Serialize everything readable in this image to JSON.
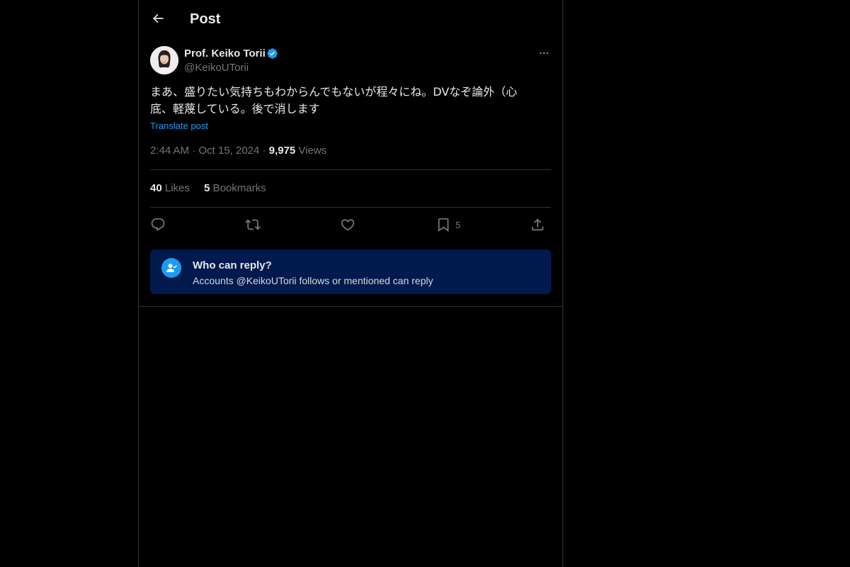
{
  "header": {
    "title": "Post"
  },
  "post": {
    "author_name": "Prof. Keiko Torii",
    "author_handle": "@KeikoUTorii",
    "verified": true,
    "text": "まあ、盛りたい気持ちもわからんでもないが程々にね。DVなぞ論外（心\n底、軽蔑している。後で消します",
    "translate_label": "Translate post",
    "timestamp": "2:44 AM · Oct 15, 2024",
    "meta_separator": " · ",
    "views_count": "9,975",
    "views_label": " Views"
  },
  "stats": {
    "likes_count": "40",
    "likes_label": " Likes",
    "bookmarks_count": "5",
    "bookmarks_label": " Bookmarks"
  },
  "actions": {
    "bookmark_count": "5"
  },
  "who_can_reply": {
    "title": "Who can reply?",
    "description": "Accounts @KeikoUTorii follows or mentioned can reply"
  },
  "colors": {
    "background": "#000000",
    "text_primary": "#e7e9ea",
    "text_secondary": "#71767b",
    "accent": "#1d9bf0",
    "border": "#2f3336",
    "reply_box": "#001a4d"
  },
  "icons": [
    "back-arrow-icon",
    "verified-badge-icon",
    "more-icon",
    "reply-icon",
    "repost-icon",
    "like-icon",
    "bookmark-icon",
    "share-icon",
    "person-check-icon"
  ]
}
